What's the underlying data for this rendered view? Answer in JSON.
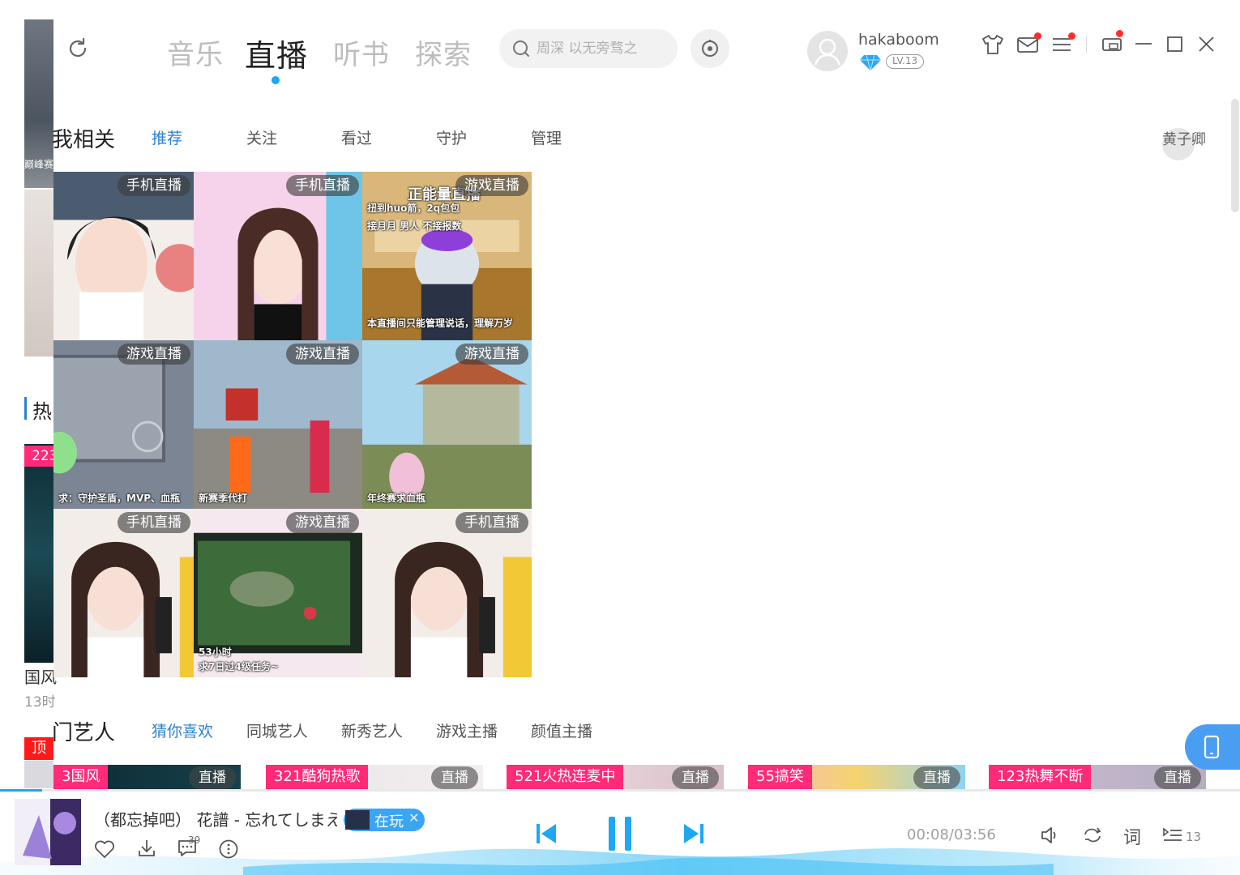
{
  "header": {
    "nav_tabs": [
      "音乐",
      "直播",
      "听书",
      "探索"
    ],
    "active_tab": "直播",
    "search_placeholder": "周深 以无旁骛之",
    "username": "hakaboom",
    "level": "LV.13"
  },
  "left_strip": {
    "hot_label": "热",
    "count_badge": "223",
    "caption_1": "国风",
    "caption_2": "13时",
    "top_badge": "顶",
    "game_caption": "巅峰赛"
  },
  "my_related": {
    "title": "我相关",
    "tabs": [
      "推荐",
      "关注",
      "看过",
      "守护",
      "管理"
    ],
    "active_tab": "推荐",
    "recommended_user": "黄子卿"
  },
  "live_grid": {
    "tiles": [
      {
        "badge": "手机直播",
        "kind": "girl1"
      },
      {
        "badge": "手机直播",
        "kind": "girl2"
      },
      {
        "badge": "游戏直播",
        "kind": "bear",
        "overlay_lines": [
          "正能量直播",
          "扭到huo箭，2q包包",
          "接月月 男人 不接报数",
          "本直播间只能管理说话，理解万岁"
        ]
      },
      {
        "badge": "游戏直播",
        "kind": "game1",
        "overlay_lines": [
          "求：守护圣盾，MVP、血瓶"
        ]
      },
      {
        "badge": "游戏直播",
        "kind": "game2",
        "overlay_lines": [
          "新赛季代打"
        ]
      },
      {
        "badge": "游戏直播",
        "kind": "game3",
        "overlay_lines": [
          "年终赛求血瓶"
        ]
      },
      {
        "badge": "手机直播",
        "kind": "girl3"
      },
      {
        "badge": "游戏直播",
        "kind": "moba",
        "overlay_lines": [
          "求7日过4级任务~",
          "53小时"
        ]
      },
      {
        "badge": "手机直播",
        "kind": "girl3"
      }
    ]
  },
  "hot_artists": {
    "title": "门艺人",
    "tabs": [
      "猜你喜欢",
      "同城艺人",
      "新秀艺人",
      "游戏主播",
      "颜值主播"
    ],
    "active_tab": "猜你喜欢",
    "cards": [
      {
        "tag": "3国风",
        "live": "直播"
      },
      {
        "tag": "321酷狗热歌",
        "live": "直播"
      },
      {
        "tag": "521火热连麦中",
        "live": "直播"
      },
      {
        "tag": "55搞笑",
        "live": "直播"
      },
      {
        "tag": "123热舞不断",
        "live": "直播"
      }
    ]
  },
  "player": {
    "song": "（都忘掉吧） 花譜 - 忘れてしまえ",
    "playing_label": "在玩",
    "comment_count": "39",
    "time": "00:08/03:56",
    "progress": 0.034,
    "lyrics_label": "词",
    "queue_count": "13"
  },
  "colors": {
    "accent": "#1ea7f3",
    "active_tab_blue": "#2d80d0",
    "tag_pink": "#ff2a78",
    "reddot": "#ff2d2d"
  }
}
